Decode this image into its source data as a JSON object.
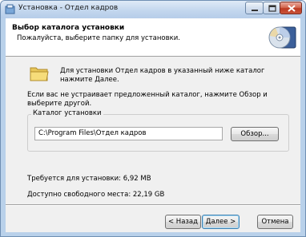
{
  "window": {
    "title": "Установка - Отдел кадров"
  },
  "header": {
    "title": "Выбор каталога установки",
    "subtitle": "Пожалуйста, выберите папку для установки."
  },
  "body": {
    "intro": "Для установки Отдел кадров  в указанный ниже каталог нажмите Далее.",
    "note": "Если вас не устраивает предложенный каталог, нажмите Обзор и выберите другой."
  },
  "install_group": {
    "label": "Каталог установки",
    "path": "C:\\Program Files\\Отдел кадров",
    "browse_label": "Обзор..."
  },
  "space": {
    "required": "Требуется для установки: 6,92 MB",
    "available": "Доступно свободного места: 22,19 GB"
  },
  "buttons": {
    "back": "< Назад",
    "next": "Далее >",
    "cancel": "Отмена"
  },
  "icons": {
    "app": "installer-app-icon",
    "header": "cd-disc-icon",
    "folder": "folder-icon",
    "minimize": "minimize-icon",
    "maximize": "maximize-icon",
    "close": "close-icon"
  },
  "colors": {
    "titlebar": "#c3d7ee",
    "close_button": "#c8533a",
    "dialog_bg": "#f0f0f0",
    "header_bg": "#ffffff",
    "default_button_border": "#3c7fb1"
  }
}
